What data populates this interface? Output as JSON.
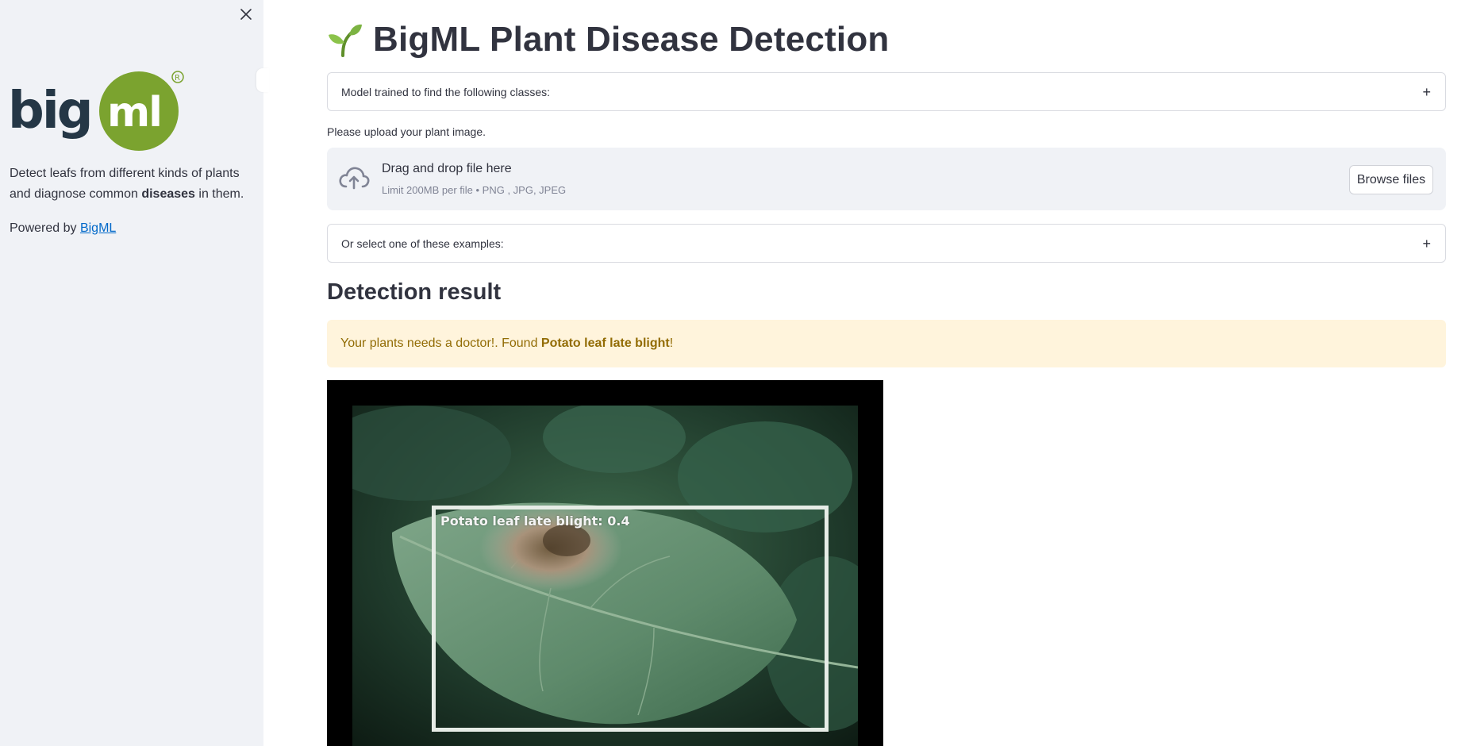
{
  "sidebar": {
    "close_icon": "close-icon",
    "logo_text": "bigml",
    "logo_registered": "®",
    "desc_part1": "Detect leafs from different kinds of plants and diagnose common ",
    "desc_bold": "diseases",
    "desc_part2": " in them.",
    "powered_prefix": "Powered by ",
    "powered_link": "BigML"
  },
  "main": {
    "title_icon": "seedling-icon",
    "title": "BigML Plant Disease Detection",
    "classes_expander": "Model trained to find the following classes:",
    "expander_toggle": "+",
    "upload_label": "Please upload your plant image.",
    "dropzone": {
      "icon": "cloud-upload-icon",
      "title": "Drag and drop file here",
      "subtitle": "Limit 200MB per file • PNG , JPG, JPEG",
      "browse_label": "Browse files"
    },
    "examples_expander": "Or select one of these examples:",
    "result_title": "Detection result",
    "alert": {
      "prefix": "Your plants needs a doctor!. Found ",
      "finding": "Potato leaf late blight",
      "suffix": "!"
    },
    "detection_label": "Potato leaf late blight: 0.4"
  },
  "colors": {
    "sidebar_bg": "#f0f2f6",
    "alert_bg": "#fff4dc",
    "alert_text": "#926c05",
    "link": "#0068c9",
    "logo_green": "#7ba32f",
    "logo_dark": "#253746"
  }
}
